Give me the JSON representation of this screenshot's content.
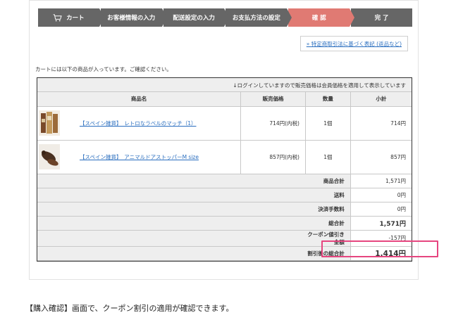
{
  "steps": [
    {
      "label": "カート",
      "icon": "cart-icon",
      "active": false
    },
    {
      "label": "お客様情報の入力",
      "active": false
    },
    {
      "label": "配送設定の入力",
      "active": false
    },
    {
      "label": "お支払方法の設定",
      "active": false
    },
    {
      "label": "確 認",
      "active": true
    },
    {
      "label": "完 了",
      "active": false
    }
  ],
  "colors": {
    "step": "#666666",
    "active_step": "#e07a73",
    "link": "#2a6ebf",
    "highlight": "#e6457f"
  },
  "law_link": "» 特定商取引法に基づく表記 (返品など)",
  "intro": "カートには以下の商品が入っています。ご確認ください。",
  "table": {
    "notice": "↓ログインしていますので販売価格は会員価格を適用して表示しています",
    "headers": {
      "name": "商品名",
      "price": "販売価格",
      "qty": "数量",
      "subtotal": "小計"
    },
    "items": [
      {
        "name": "【スペイン雑貨】　レトロなラベルのマッチ（1）",
        "price": "714円(内税)",
        "qty": "1個",
        "subtotal": "714円",
        "thumb": "match-box-thumbnail"
      },
      {
        "name": "【スペイン雑貨】　アニマルドアストッパーM size",
        "price": "857円(内税)",
        "qty": "1個",
        "subtotal": "857円",
        "thumb": "door-stopper-thumbnail"
      }
    ],
    "summary": {
      "goods_total_label": "商品合計",
      "goods_total": "1,571円",
      "shipping_label": "送料",
      "shipping": "0円",
      "fee_label": "決済手数料",
      "fee": "0円",
      "grand_total_label": "総合計",
      "grand_total": "1,571円",
      "coupon_label": "クーポン値引き金額",
      "coupon": "-157円",
      "after_discount_label": "割引後の総合計",
      "after_discount": "1,414円"
    }
  },
  "caption": "【購入確認】画面で、クーポン割引の適用が確認できます。"
}
